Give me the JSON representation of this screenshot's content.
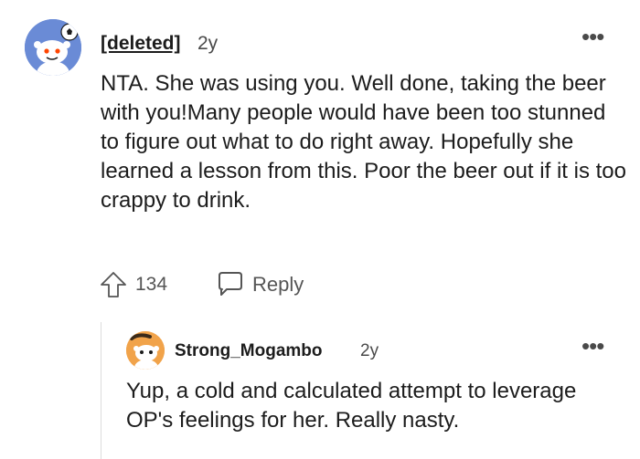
{
  "comment": {
    "username": "[deleted]",
    "age": "2y",
    "body": "NTA. She was using you. Well done, taking the beer with you!Many people would have been too stunned to figure out what to do right away. Hopefully she learned a lesson from this. Poor the beer out if it is too crappy to drink.",
    "vote_count": "134",
    "reply_label": "Reply",
    "more_label": "•••",
    "avatar_icon": "snoo-avatar-icon",
    "upvote_icon": "upvote-arrow-icon",
    "reply_icon": "speech-bubble-icon"
  },
  "reply": {
    "username": "Strong_Mogambo",
    "age": "2y",
    "body": "Yup, a cold and calculated attempt to leverage OP's feelings for her. Really nasty.",
    "more_label": "•••",
    "avatar_icon": "snoo-avatar-icon"
  },
  "colors": {
    "text": "#1c1c1c",
    "muted": "#555555",
    "avatar_main_bg": "#6a8bd6",
    "avatar_reply_bg": "#f1a34a"
  }
}
